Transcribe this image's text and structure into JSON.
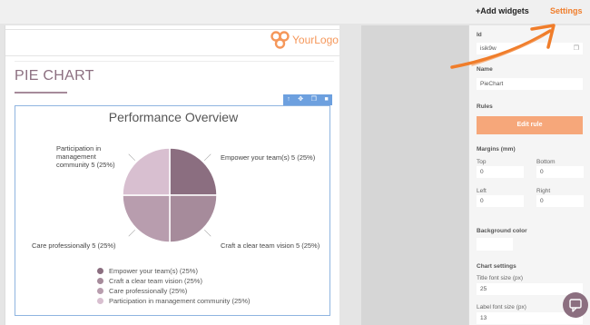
{
  "topbar": {
    "add_widgets": "+Add widgets",
    "settings": "Settings"
  },
  "logo": {
    "text": "YourLogo"
  },
  "page": {
    "title": "PIE CHART"
  },
  "chart_data": {
    "type": "pie",
    "title": "Performance Overview",
    "categories": [
      "Empower your team(s)",
      "Craft a clear team vision",
      "Care professionally",
      "Participation in management community"
    ],
    "values": [
      5,
      5,
      5,
      5
    ],
    "percents": [
      25,
      25,
      25,
      25
    ],
    "colors": [
      "#8b6e80",
      "#a68b9b",
      "#b89dae",
      "#d8bfd0"
    ],
    "slice_labels": [
      "Empower your team(s) 5 (25%)",
      "Craft a clear team vision 5 (25%)",
      "Care professionally 5 (25%)",
      "Participation in management community 5 (25%)"
    ],
    "slice_label_lines": {
      "participation": [
        "Participation in",
        "management",
        "community 5 (25%)"
      ]
    },
    "legend": [
      "Empower your team(s) (25%)",
      "Craft a clear team vision (25%)",
      "Care professionally (25%)",
      "Participation in management community (25%)"
    ],
    "legend_position": "bottom"
  },
  "panel": {
    "id_label": "Id",
    "id_value": "isik9w",
    "name_label": "Name",
    "name_value": "PieChart",
    "rules_label": "Rules",
    "edit_rule": "Edit rule",
    "margins_label": "Margins (mm)",
    "top_label": "Top",
    "top_value": "0",
    "bottom_label": "Bottom",
    "bottom_value": "0",
    "left_label": "Left",
    "left_value": "0",
    "right_label": "Right",
    "right_value": "0",
    "bg_label": "Background color",
    "chart_settings_label": "Chart settings",
    "title_font_label": "Title font size (px)",
    "title_font_value": "25",
    "label_font_label": "Label font size (px)",
    "label_font_value": "13"
  },
  "colors": {
    "accent": "#f07d2a",
    "brand": "#8c6f80",
    "selection": "#6da0df"
  }
}
